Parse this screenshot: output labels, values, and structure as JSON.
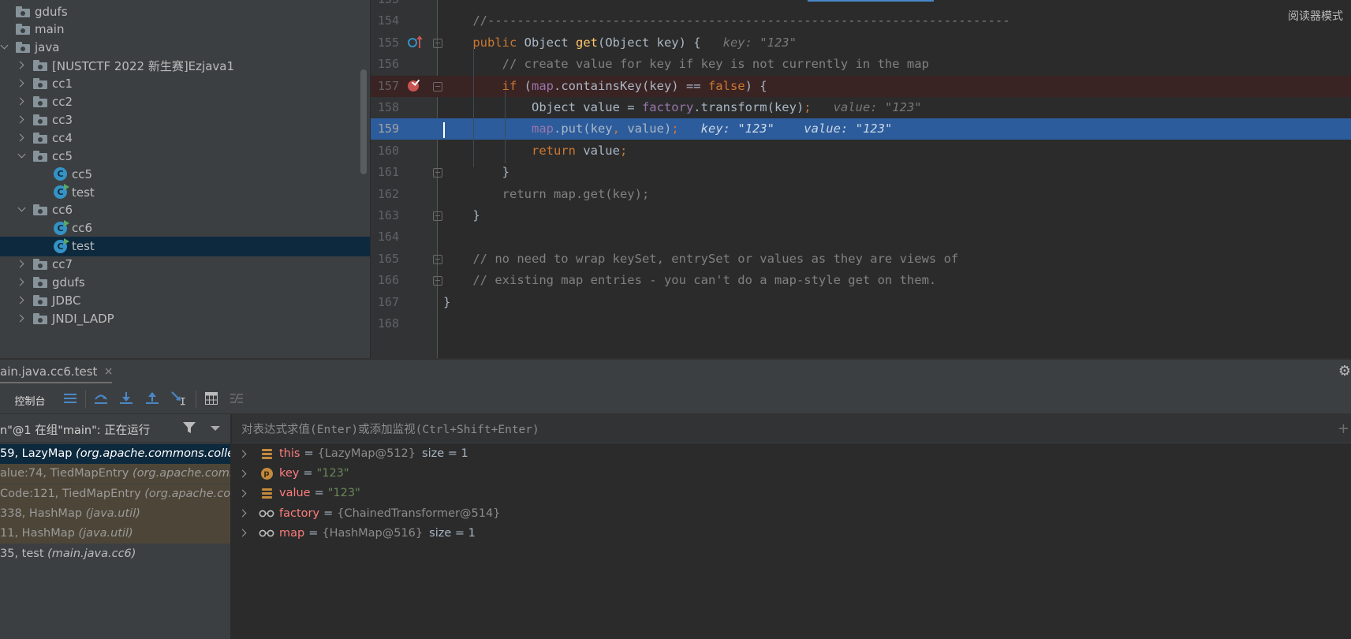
{
  "project": {
    "items": [
      {
        "label": "gdufs",
        "type": "folder",
        "arrow": "none",
        "indent": 14
      },
      {
        "label": "main",
        "type": "folder",
        "arrow": "none",
        "indent": 14
      },
      {
        "label": "java",
        "type": "folder",
        "arrow": "open",
        "indent": 14
      },
      {
        "label": "[NUSTCTF 2022 新生赛]Ezjava1",
        "type": "folder",
        "arrow": "closed",
        "indent": 36
      },
      {
        "label": "cc1",
        "type": "folder",
        "arrow": "closed",
        "indent": 36
      },
      {
        "label": "cc2",
        "type": "folder",
        "arrow": "closed",
        "indent": 36
      },
      {
        "label": "cc3",
        "type": "folder",
        "arrow": "closed",
        "indent": 36
      },
      {
        "label": "cc4",
        "type": "folder",
        "arrow": "closed",
        "indent": 36
      },
      {
        "label": "cc5",
        "type": "folder",
        "arrow": "open",
        "indent": 36
      },
      {
        "label": "cc5",
        "type": "class",
        "arrow": "none",
        "indent": 62
      },
      {
        "label": "test",
        "type": "class-run",
        "arrow": "none",
        "indent": 62
      },
      {
        "label": "cc6",
        "type": "folder",
        "arrow": "open",
        "indent": 36
      },
      {
        "label": "cc6",
        "type": "class-run",
        "arrow": "none",
        "indent": 62
      },
      {
        "label": "test",
        "type": "class-run",
        "arrow": "none",
        "indent": 62,
        "selected": true
      },
      {
        "label": "cc7",
        "type": "folder",
        "arrow": "closed",
        "indent": 36
      },
      {
        "label": "gdufs",
        "type": "folder",
        "arrow": "closed",
        "indent": 36
      },
      {
        "label": "JDBC",
        "type": "folder",
        "arrow": "closed",
        "indent": 36
      },
      {
        "label": "JNDI_LADP",
        "type": "folder",
        "arrow": "closed",
        "indent": 36
      }
    ]
  },
  "editor": {
    "reader_mode": "阅读器模式",
    "lines": [
      {
        "num": "153",
        "html": ""
      },
      {
        "num": "154",
        "html": "    <span class=\"cm\">//-----------------------------------------------------------------------</span>"
      },
      {
        "num": "155",
        "html": "    <span class=\"kw\">public</span> Object <span class=\"fn\">get</span>(Object key) {   <span class=\"hint\">key: \"123\"</span>"
      },
      {
        "num": "156",
        "html": "        <span class=\"cm\">// create value for key if key is not currently in the map</span>"
      },
      {
        "num": "157",
        "html": "        <span class=\"kw\">if</span> (<span class=\"fld\">map</span>.containsKey(key) == <span class=\"kw\">false</span>) {",
        "cls": "bp"
      },
      {
        "num": "158",
        "html": "            Object value = <span class=\"fld\">factory</span>.transform(key)<span class=\"kw\">;</span>   <span class=\"hint\">value: \"123\"</span>"
      },
      {
        "num": "159",
        "html": "            <span class=\"fld\">map</span>.put(key<span class=\"kw\">,</span> value)<span class=\"kw\">;</span>   <span class=\"hint\">key: \"123\"    value: \"123\"</span>",
        "cls": "exec"
      },
      {
        "num": "160",
        "html": "            <span class=\"kw\">return</span> value<span class=\"kw\">;</span>"
      },
      {
        "num": "161",
        "html": "        }"
      },
      {
        "num": "162",
        "html": "        <span class=\"cm\">return map.get(key);</span>"
      },
      {
        "num": "163",
        "html": "    }"
      },
      {
        "num": "164",
        "html": ""
      },
      {
        "num": "165",
        "html": "    <span class=\"cm\">// no need to wrap keySet, entrySet or values as they are views of</span>"
      },
      {
        "num": "166",
        "html": "    <span class=\"cm\">// existing map entries - you can't do a map-style get on them.</span>"
      },
      {
        "num": "167",
        "html": "}"
      },
      {
        "num": "168",
        "html": ""
      }
    ]
  },
  "debug": {
    "tab_label": "ain.java.cc6.test",
    "tab_close": "×",
    "console_label": "控制台",
    "thread_label": "n\"@1 在组\"main\": 正在运行",
    "eval_placeholder": "对表达式求值(Enter)或添加监视(Ctrl+Shift+Enter)",
    "frames": [
      {
        "main": "59, LazyMap ",
        "pkg": "(org.apache.commons.collections.map)",
        "style": "sel"
      },
      {
        "main": "alue:74, TiedMapEntry ",
        "pkg": "(org.apache.commons.collections.keyvalue)",
        "style": "lib"
      },
      {
        "main": "Code:121, TiedMapEntry ",
        "pkg": "(org.apache.commons.collections.keyvalue)",
        "style": "lib"
      },
      {
        "main": "338, HashMap ",
        "pkg": "(java.util)",
        "style": "lib"
      },
      {
        "main": "11, HashMap ",
        "pkg": "(java.util)",
        "style": "lib"
      },
      {
        "main": "35, test ",
        "pkg": "(main.java.cc6)",
        "style": ""
      }
    ],
    "variables": [
      {
        "icon": "field",
        "name": "this",
        "value": "{LazyMap@512}",
        "kind": "ref",
        "extra": "size = 1"
      },
      {
        "icon": "param",
        "name": "key",
        "value": "\"123\"",
        "kind": "str",
        "extra": ""
      },
      {
        "icon": "field",
        "name": "value",
        "value": "\"123\"",
        "kind": "str",
        "extra": ""
      },
      {
        "icon": "watch",
        "name": "factory",
        "value": "{ChainedTransformer@514}",
        "kind": "ref",
        "extra": ""
      },
      {
        "icon": "watch",
        "name": "map",
        "value": "{HashMap@516}",
        "kind": "ref",
        "extra": "size = 1"
      }
    ]
  }
}
